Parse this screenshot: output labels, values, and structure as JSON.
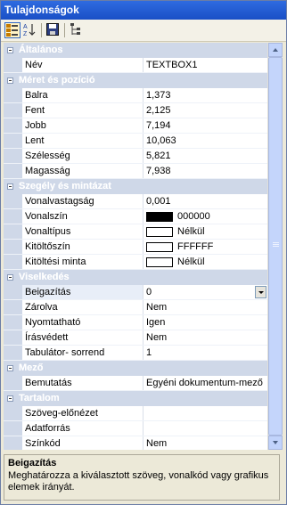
{
  "window": {
    "title": "Tulajdonságok"
  },
  "toolbar": {
    "buttons": [
      "categorized-icon",
      "alphabetical-icon",
      "save-icon",
      "tree-icon"
    ]
  },
  "categories": [
    {
      "name": "Általános",
      "rows": [
        {
          "name": "Név",
          "value": "TEXTBOX1"
        }
      ]
    },
    {
      "name": "Méret és pozíció",
      "rows": [
        {
          "name": "Balra",
          "value": "1,373"
        },
        {
          "name": "Fent",
          "value": "2,125"
        },
        {
          "name": "Jobb",
          "value": "7,194"
        },
        {
          "name": "Lent",
          "value": "10,063"
        },
        {
          "name": "Szélesség",
          "value": "5,821"
        },
        {
          "name": "Magasság",
          "value": "7,938"
        }
      ]
    },
    {
      "name": "Szegély és mintázat",
      "rows": [
        {
          "name": "Vonalvastagság",
          "value": "0,001"
        },
        {
          "name": "Vonalszín",
          "value": "000000",
          "swatch": "#000000"
        },
        {
          "name": "Vonaltípus",
          "value": "Nélkül",
          "swatch": "#ffffff"
        },
        {
          "name": "Kitöltőszín",
          "value": "FFFFFF",
          "swatch": "#ffffff"
        },
        {
          "name": "Kitöltési minta",
          "value": "Nélkül",
          "swatch": "#ffffff"
        }
      ]
    },
    {
      "name": "Viselkedés",
      "rows": [
        {
          "name": "Beigazítás",
          "value": "0",
          "dropdown": true,
          "selected": true
        },
        {
          "name": "Zárolva",
          "value": "Nem"
        },
        {
          "name": "Nyomtatható",
          "value": "Igen"
        },
        {
          "name": "Írásvédett",
          "value": "Nem"
        },
        {
          "name": "Tabulátor- sorrend",
          "value": "1"
        }
      ]
    },
    {
      "name": "Mező",
      "rows": [
        {
          "name": "Bemutatás",
          "value": "Egyéni dokumentum-mező"
        }
      ]
    },
    {
      "name": "Tartalom",
      "rows": [
        {
          "name": "Szöveg-előnézet",
          "value": ""
        },
        {
          "name": "Adatforrás",
          "value": ""
        },
        {
          "name": "Színkód",
          "value": "Nem"
        }
      ]
    }
  ],
  "help": {
    "title": "Beigazítás",
    "description": "Meghatározza a kiválasztott szöveg, vonalkód vagy grafikus elemek irányát."
  }
}
